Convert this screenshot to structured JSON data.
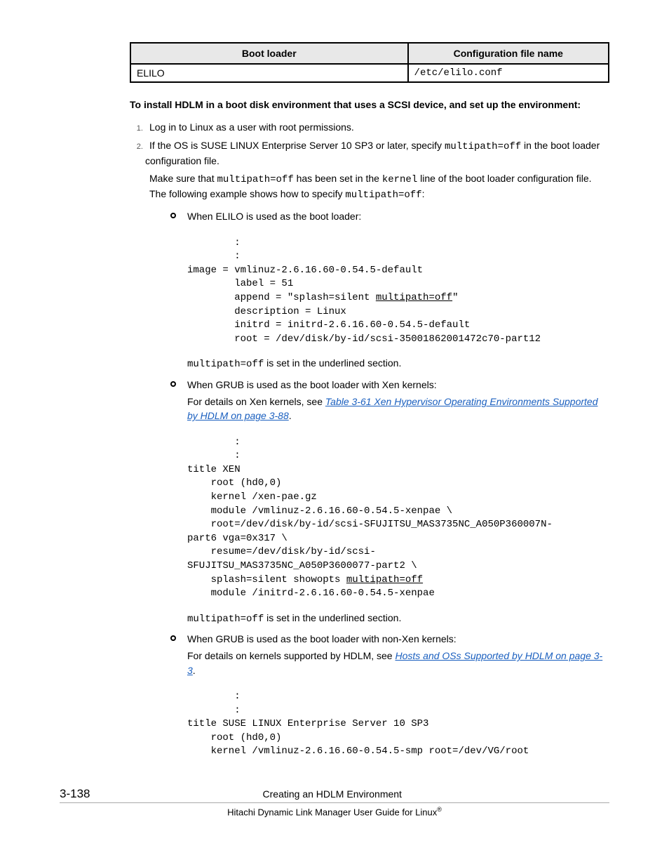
{
  "table": {
    "headers": {
      "bootloader": "Boot loader",
      "filename": "Configuration file name"
    },
    "row": {
      "bootloader": "ELILO",
      "filename": "/etc/elilo.conf"
    }
  },
  "heading": "To install HDLM in a boot disk environment that uses a SCSI device, and set up the environment:",
  "step1": "Log in to Linux as a user with root permissions.",
  "step2": {
    "p1_a": "If the OS is SUSE LINUX Enterprise Server 10 SP3 or later, specify ",
    "p1_code": "multipath=off",
    "p1_b": " in the boot loader configuration file.",
    "p2_a": "Make sure that ",
    "p2_c1": "multipath=off",
    "p2_b": " has been set in the ",
    "p2_c2": "kernel",
    "p2_c": " line of the boot loader configuration file. The following example shows how to specify ",
    "p2_c3": "multipath=off",
    "p2_d": ":"
  },
  "bullets": {
    "elilo": {
      "title": "When ELILO is used as the boot loader:",
      "code_pre": "        :\n        :\nimage = vmlinuz-2.6.16.60-0.54.5-default\n        label = 51\n        append = \"splash=silent ",
      "code_underlined": "multipath=off",
      "code_post": "\"\n        description = Linux\n        initrd = initrd-2.6.16.60-0.54.5-default\n        root = /dev/disk/by-id/scsi-35001862001472c70-part12",
      "after_a": "multipath=off",
      "after_b": " is set in the underlined section."
    },
    "grubxen": {
      "title": "When GRUB is used as the boot loader with Xen kernels:",
      "desc_a": "For details on Xen kernels, see ",
      "link": "Table 3-61 Xen Hypervisor Operating Environments Supported by HDLM on page 3-88",
      "desc_b": ".",
      "code_pre": "        :\n        :\ntitle XEN\n    root (hd0,0)\n    kernel /xen-pae.gz\n    module /vmlinuz-2.6.16.60-0.54.5-xenpae \\\n    root=/dev/disk/by-id/scsi-SFUJITSU_MAS3735NC_A050P360007N-\npart6 vga=0x317 \\\n    resume=/dev/disk/by-id/scsi-\nSFUJITSU_MAS3735NC_A050P3600077-part2 \\\n    splash=silent showopts ",
      "code_underlined": "multipath=off",
      "code_post": "\n    module /initrd-2.6.16.60-0.54.5-xenpae",
      "after_a": "multipath=off",
      "after_b": " is set in the underlined section."
    },
    "grubnon": {
      "title": "When GRUB is used as the boot loader with non-Xen kernels:",
      "desc_a": "For details on kernels supported by HDLM, see ",
      "link": "Hosts and OSs Supported by HDLM on page 3-3",
      "desc_b": ".",
      "code": "        :\n        :\ntitle SUSE LINUX Enterprise Server 10 SP3\n    root (hd0,0)\n    kernel /vmlinuz-2.6.16.60-0.54.5-smp root=/dev/VG/root"
    }
  },
  "footer": {
    "pagenum": "3-138",
    "section": "Creating an HDLM Environment",
    "book": "Hitachi Dynamic Link Manager User Guide for Linux",
    "reg": "®"
  }
}
